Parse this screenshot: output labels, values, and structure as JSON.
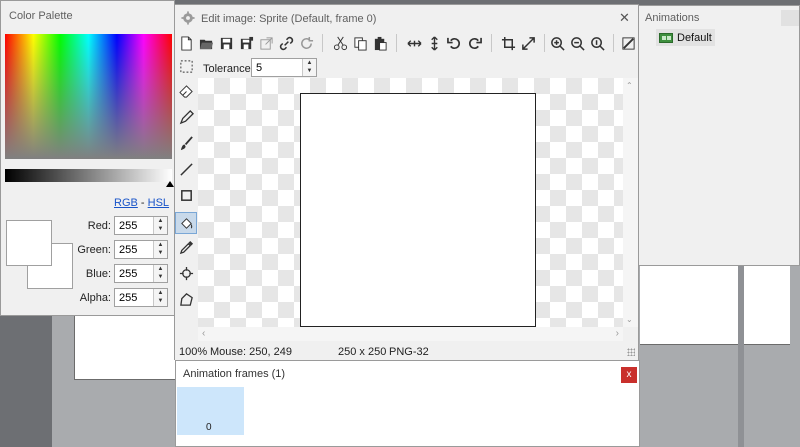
{
  "color_palette": {
    "title": "Color Palette",
    "mode_links": {
      "rgb": "RGB",
      "separator": "-",
      "hsl": "HSL"
    },
    "channels": [
      {
        "label": "Red:",
        "value": "255"
      },
      {
        "label": "Green:",
        "value": "255"
      },
      {
        "label": "Blue:",
        "value": "255"
      },
      {
        "label": "Alpha:",
        "value": "255"
      }
    ]
  },
  "editor": {
    "title": "Edit image: Sprite (Default, frame 0)",
    "close_glyph": "✕",
    "tolerance_label": "Tolerance",
    "tolerance_value": "5",
    "status": {
      "zoom": "100%",
      "mouse": "Mouse: 250, 249",
      "size": "250 x 250",
      "format": "PNG-32"
    }
  },
  "animations": {
    "title": "Animations",
    "items": [
      {
        "label": "Default"
      }
    ]
  },
  "frames": {
    "title": "Animation frames (1)",
    "close_glyph": "x",
    "items": [
      {
        "label": "0"
      }
    ]
  },
  "colors": {
    "accent": "#cde6fb",
    "close_red": "#c9302c"
  }
}
